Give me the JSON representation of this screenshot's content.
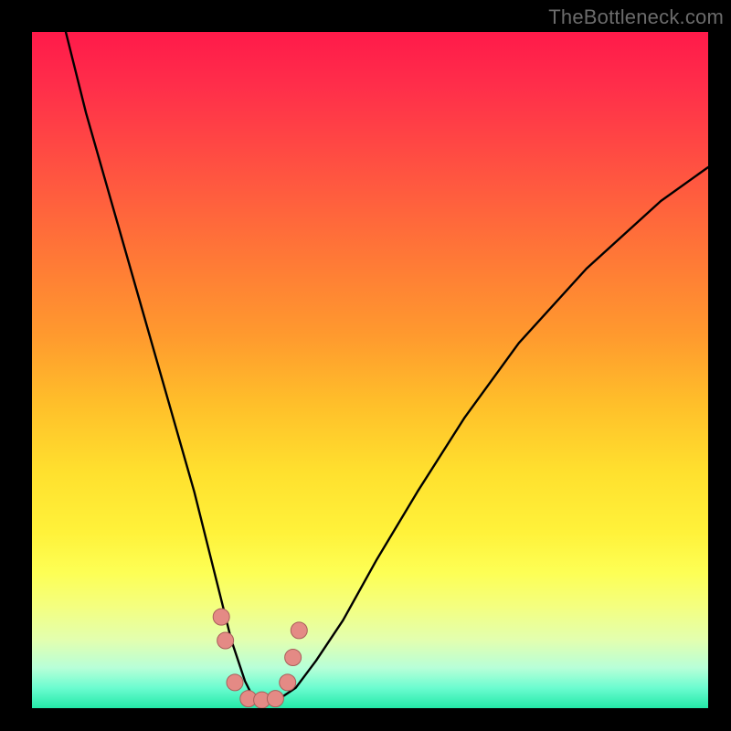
{
  "watermark": {
    "text": "TheBottleneck.com"
  },
  "colors": {
    "curve_stroke": "#000000",
    "marker_fill": "#e48a85",
    "marker_stroke": "#a85f5b",
    "frame_bg": "#000000"
  },
  "chart_data": {
    "type": "line",
    "title": "",
    "xlabel": "",
    "ylabel": "",
    "xlim": [
      0,
      100
    ],
    "ylim": [
      0,
      100
    ],
    "grid": false,
    "legend": false,
    "note": "V-shaped bottleneck curve over rainbow heatmap background. Values estimated from pixel positions; axes have no visible ticks or labels.",
    "series": [
      {
        "name": "bottleneck_curve",
        "x": [
          5,
          8,
          12,
          16,
          20,
          24,
          27,
          29.5,
          31.5,
          33,
          36,
          39,
          42,
          46,
          51,
          57,
          64,
          72,
          82,
          93,
          100
        ],
        "y": [
          100,
          88,
          74,
          60,
          46,
          32,
          20,
          10,
          4,
          1,
          1,
          3,
          7,
          13,
          22,
          32,
          43,
          54,
          65,
          75,
          80
        ]
      }
    ],
    "markers": {
      "name": "highlight_points",
      "shape": "circle",
      "radius_px": 9,
      "x": [
        28.0,
        28.6,
        30.0,
        32.0,
        34.0,
        36.0,
        37.8,
        38.6,
        39.5
      ],
      "y": [
        13.5,
        10.0,
        3.8,
        1.4,
        1.2,
        1.4,
        3.8,
        7.5,
        11.5
      ]
    }
  }
}
